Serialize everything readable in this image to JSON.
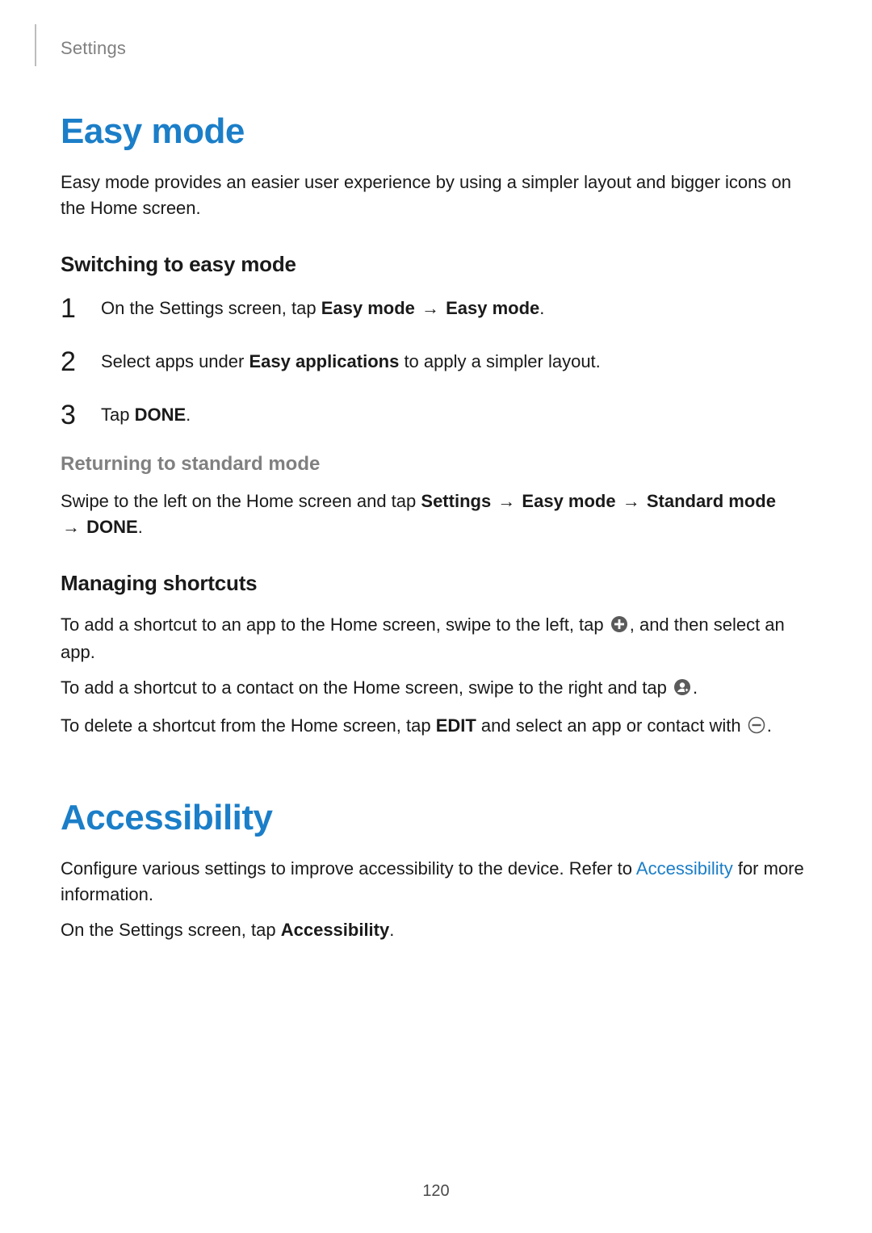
{
  "header": {
    "breadcrumb": "Settings"
  },
  "easy_mode": {
    "title": "Easy mode",
    "intro": "Easy mode provides an easier user experience by using a simpler layout and bigger icons on the Home screen.",
    "switching_heading": "Switching to easy mode",
    "steps": {
      "s1_pre": "On the Settings screen, tap ",
      "s1_b1": "Easy mode",
      "s1_arrow": " → ",
      "s1_b2": "Easy mode",
      "s1_post": ".",
      "s2_pre": "Select apps under ",
      "s2_b": "Easy applications",
      "s2_post": " to apply a simpler layout.",
      "s3_pre": "Tap ",
      "s3_b": "DONE",
      "s3_post": "."
    },
    "returning_heading": "Returning to standard mode",
    "returning": {
      "pre": "Swipe to the left on the Home screen and tap ",
      "b1": "Settings",
      "a1": " → ",
      "b2": "Easy mode",
      "a2": " → ",
      "b3": "Standard mode",
      "a3": " → ",
      "b4": "DONE",
      "post": "."
    },
    "managing_heading": "Managing shortcuts",
    "managing": {
      "l1_pre": "To add a shortcut to an app to the Home screen, swipe to the left, tap ",
      "l1_post": ", and then select an app.",
      "l2_pre": "To add a shortcut to a contact on the Home screen, swipe to the right and tap ",
      "l2_post": ".",
      "l3_pre": "To delete a shortcut from the Home screen, tap ",
      "l3_b": "EDIT",
      "l3_mid": " and select an app or contact with ",
      "l3_post": "."
    }
  },
  "accessibility": {
    "title": "Accessibility",
    "p1_pre": "Configure various settings to improve accessibility to the device. Refer to ",
    "p1_link": "Accessibility",
    "p1_post": " for more information.",
    "p2_pre": "On the Settings screen, tap ",
    "p2_b": "Accessibility",
    "p2_post": "."
  },
  "page_number": "120"
}
